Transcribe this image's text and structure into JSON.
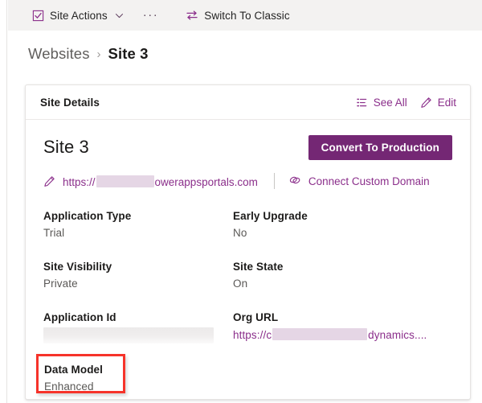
{
  "command_bar": {
    "site_actions": {
      "label": "Site Actions",
      "icon": "checkbox-checked-icon",
      "chevron": "chevron-down-icon"
    },
    "overflow_label": "···",
    "switch_to_classic": {
      "label": "Switch To Classic",
      "icon": "swap-arrows-icon"
    }
  },
  "breadcrumb": {
    "parent": "Websites",
    "separator": "›",
    "current": "Site 3"
  },
  "card": {
    "header": {
      "title": "Site Details",
      "see_all": "See All",
      "see_all_icon": "list-icon",
      "edit": "Edit",
      "edit_icon": "pencil-icon"
    },
    "site_name": "Site 3",
    "primary_button": "Convert To Production",
    "url": {
      "edit_icon": "pencil-icon",
      "prefix": "https://",
      "redacted": true,
      "suffix": "owerappsportals.com"
    },
    "connect_custom_domain": {
      "label": "Connect Custom Domain",
      "icon": "link-icon"
    },
    "fields": [
      {
        "label": "Application Type",
        "value": "Trial",
        "type": "text"
      },
      {
        "label": "Early Upgrade",
        "value": "No",
        "type": "text"
      },
      {
        "label": "Site Visibility",
        "value": "Private",
        "type": "text"
      },
      {
        "label": "Site State",
        "value": "On",
        "type": "text"
      },
      {
        "label": "Application Id",
        "value": "",
        "type": "redacted-gray"
      },
      {
        "label": "Org URL",
        "prefix": "https://c",
        "suffix": "dynamics....",
        "type": "redacted-link"
      },
      {
        "label": "Data Model",
        "value": "Enhanced",
        "type": "text",
        "highlighted": true
      }
    ]
  },
  "colors": {
    "accent_purple": "#8b2f8b",
    "button_purple": "#742774",
    "highlight_red": "#f6332a",
    "command_bar_bg": "#f3f2f1",
    "redaction_pink": "#e5d6e5"
  }
}
